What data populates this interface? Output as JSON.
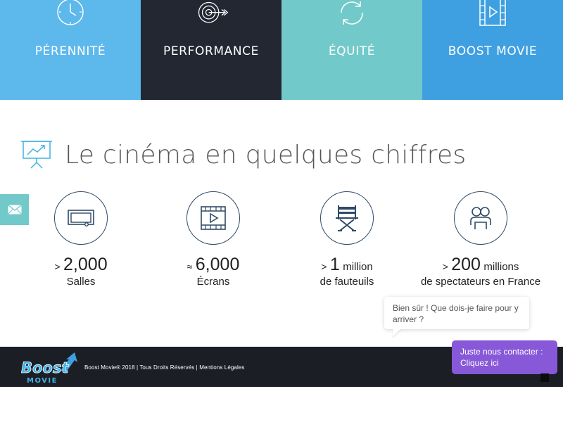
{
  "tiles": [
    {
      "label": "PÉRENNITÉ",
      "icon": "clock-icon"
    },
    {
      "label": "PERFORMANCE",
      "icon": "target-icon"
    },
    {
      "label": "ÉQUITÉ",
      "icon": "refresh-icon"
    },
    {
      "label": "BOOST MOVIE",
      "icon": "film-icon"
    }
  ],
  "section": {
    "title": "Le cinéma en quelques chiffres",
    "icon": "presentation-chart-icon"
  },
  "side_tab": {
    "icon": "mail-icon"
  },
  "stats": [
    {
      "prefix": ">",
      "number": "2,000",
      "unit": "",
      "label": "Salles",
      "icon": "cinema-screen-icon"
    },
    {
      "prefix": "≈",
      "number": "6,000",
      "unit": "",
      "label": "Écrans",
      "icon": "film-play-icon"
    },
    {
      "prefix": ">",
      "number": "1",
      "unit": "million",
      "label": "de fauteuils",
      "icon": "director-chair-icon"
    },
    {
      "prefix": ">",
      "number": "200",
      "unit": "millions",
      "label": "de spectateurs en France",
      "icon": "people-icon"
    }
  ],
  "chat": {
    "bubble_text": "Bien sûr ! Que dois-je faire pour y arriver ?",
    "contact_line1": "Juste nous contacter :",
    "contact_line2": "Cliquez ici"
  },
  "footer": {
    "logo_top": "Boost",
    "logo_bottom": "MOVIE",
    "copyright": "Boost Movie® 2018",
    "rights": "Tous Droits Réservés",
    "legal": "Mentions Légales",
    "separator": " | "
  },
  "colors": {
    "tile1": "#5db8ec",
    "tile2": "#222732",
    "tile3": "#72c9ca",
    "tile4": "#3fa0e1",
    "icon_navy": "#2f4a66",
    "contact_purple": "#8758d8",
    "footer_bg": "#1c1e25"
  }
}
